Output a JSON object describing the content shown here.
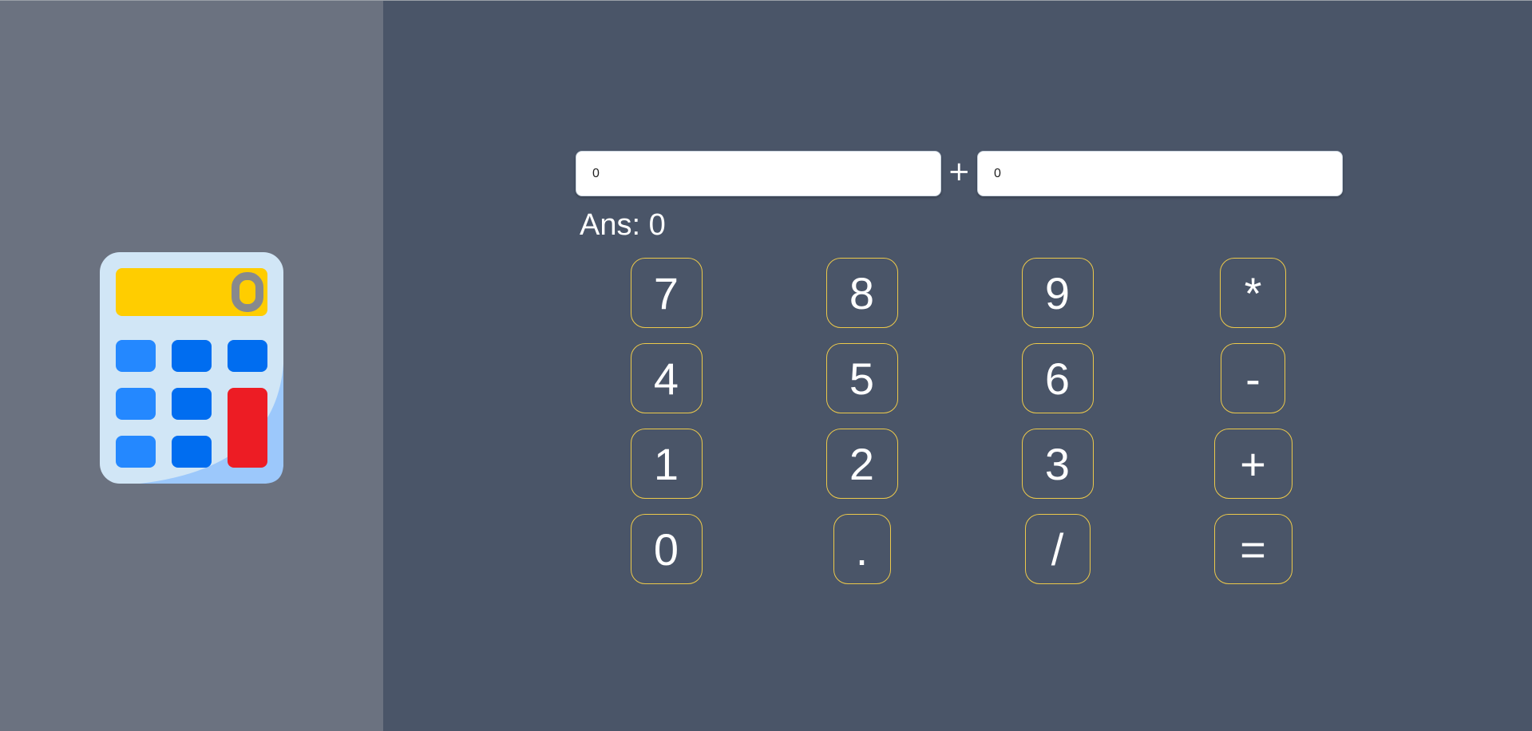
{
  "operand1": "0",
  "operator": "+",
  "operand2": "0",
  "answer_label": "Ans: 0",
  "logo": {
    "display_digit": "0"
  },
  "keys": [
    "7",
    "8",
    "9",
    "*",
    "4",
    "5",
    "6",
    "-",
    "1",
    "2",
    "3",
    "+",
    "0",
    ".",
    "/",
    "="
  ],
  "colors": {
    "sidebar": "#6b7280",
    "main": "#4a5568",
    "key_border": "#ecc94b"
  }
}
